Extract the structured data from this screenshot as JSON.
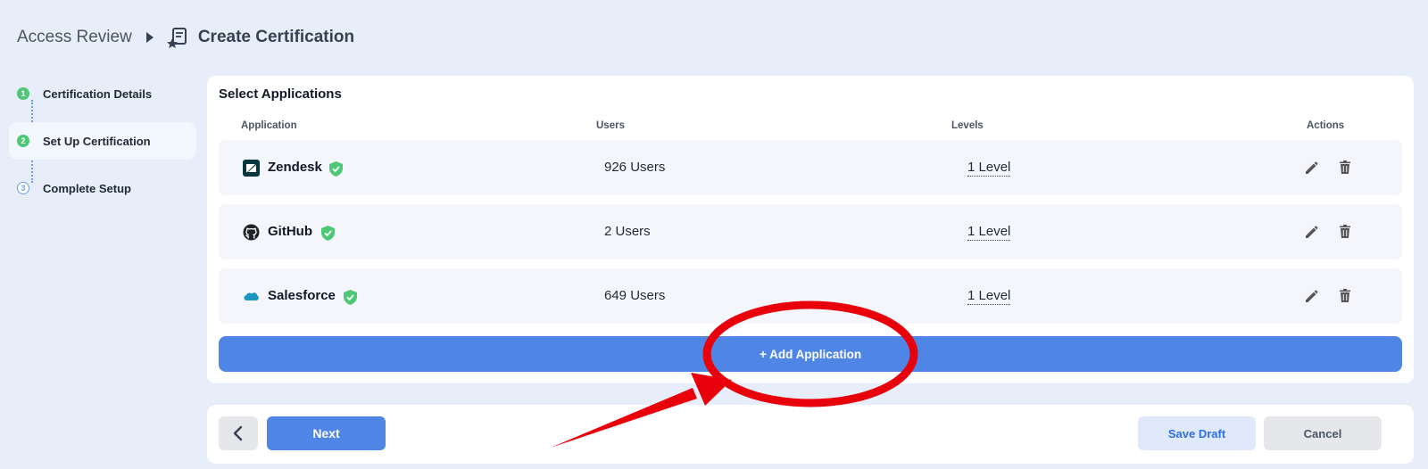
{
  "breadcrumb": {
    "root": "Access Review",
    "title": "Create Certification",
    "icon": "certificate-icon"
  },
  "stepper": {
    "steps": [
      {
        "number": "1",
        "label": "Certification Details",
        "state": "done"
      },
      {
        "number": "2",
        "label": "Set Up Certification",
        "state": "active"
      },
      {
        "number": "3",
        "label": "Complete Setup",
        "state": "pending"
      }
    ]
  },
  "main": {
    "title": "Select Applications",
    "columns": {
      "application": "Application",
      "users": "Users",
      "levels": "Levels",
      "actions": "Actions"
    },
    "rows": [
      {
        "name": "Zendesk",
        "users": "926 Users",
        "levels": "1 Level",
        "icon": "zendesk-logo-icon",
        "verified": true
      },
      {
        "name": "GitHub",
        "users": "2 Users",
        "levels": "1 Level",
        "icon": "github-logo-icon",
        "verified": true
      },
      {
        "name": "Salesforce",
        "users": "649 Users",
        "levels": "1 Level",
        "icon": "salesforce-logo-icon",
        "verified": true
      }
    ],
    "add_button": "+ Add Application"
  },
  "footer": {
    "next": "Next",
    "save_draft": "Save Draft",
    "cancel": "Cancel"
  },
  "colors": {
    "primary": "#4f86e5",
    "success": "#4ec776",
    "background": "#e8eef9",
    "annotation": "#e8000b"
  }
}
